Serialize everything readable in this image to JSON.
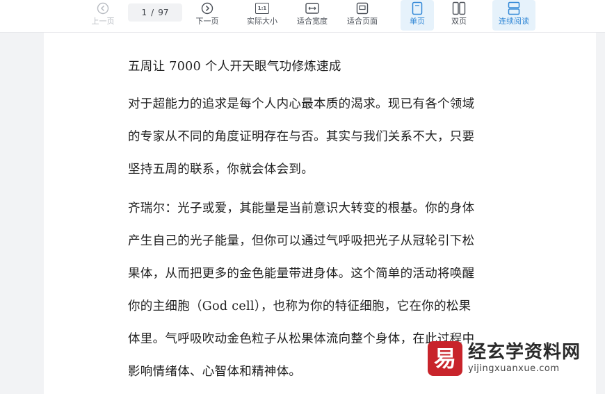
{
  "toolbar": {
    "prev_label": "上一页",
    "next_label": "下一页",
    "actual_size_label": "实际大小",
    "fit_width_label": "适合宽度",
    "fit_page_label": "适合页面",
    "single_label": "单页",
    "double_label": "双页",
    "continuous_label": "连续阅读",
    "actual_size_glyph": "1:1",
    "page_current": "1",
    "page_separator": "/",
    "page_total": "97"
  },
  "document": {
    "title": "五周让 7000 个人开天眼气功修炼速成",
    "para1": [
      "对于超能力的追求是每个人内心最本质的渴求。现已有各个领域",
      "的专家从不同的角度证明存在与否。其实与我们关系不大，只要",
      "坚持五周的联系，你就会体会到。"
    ],
    "para2": [
      "齐瑞尔：光子或爱，其能量是当前意识大转变的根基。你的身体",
      "产生自己的光子能量，但你可以通过气呼吸把光子从冠轮引下松",
      "果体，从而把更多的金色能量带进身体。这个简单的活动将唤醒",
      "你的主细胞（God cell），也称为你的特征细胞，它在你的松果",
      "体里。气呼吸吹动金色粒子从松果体流向整个身体，在此过程中",
      "影响情绪体、心智体和精神体。"
    ]
  },
  "watermark": {
    "name": "经玄学资料网",
    "url": "yijingxuanxue.com",
    "logo_glyph": "易"
  },
  "colors": {
    "accent": "#2f86d6",
    "active_bg": "#e6f2fb",
    "logo_red": "#c8242b"
  }
}
